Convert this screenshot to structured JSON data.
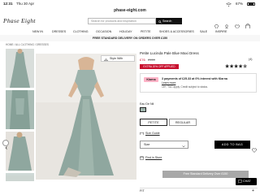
{
  "status": {
    "time": "12:31",
    "date": "Thu 30 Apr",
    "battery": "67%"
  },
  "browser": {
    "url": "phase-eight.com"
  },
  "header": {
    "logo": "Phase Eight",
    "search_placeholder": "Search for products and inspiration",
    "search_button": "Search"
  },
  "nav": {
    "items": [
      "NEW IN",
      "DRESSES",
      "CLOTHING",
      "OCCASION",
      "HOLIDAY",
      "PETITE",
      "SHOES & ACCESSORIES",
      "SALE",
      "INSPIRE"
    ]
  },
  "promo": {
    "text": "FREE STANDARD DELIVERY ON ORDERS OVER £150"
  },
  "breadcrumb": "HOME / ALL CLOTHING / DRESSES",
  "gallery": {
    "style_with": "Style With"
  },
  "product": {
    "name": "Petite Lucinda Pale Blue Maxi Dress",
    "price_now": "£76",
    "price_was": "£169",
    "discount_badge": "EXTRA 20% OFF APPLIED",
    "rating_count": "(4)",
    "stars": 4.5,
    "klarna_label": "Klarna",
    "klarna_line1": "3 payments of £25.33 at 0% interest with Klarna",
    "klarna_link": "Learn more",
    "klarna_line2": "18+, T&C apply, Credit subject to status.",
    "colour_label": "Eau De Nil",
    "fit_options": [
      "PETITE",
      "REGULAR"
    ],
    "size_guide": "Size Guide",
    "size_label": "Size",
    "add_to_bag": "ADD TO BAG",
    "find_in_store": "Find in Store",
    "delivery_banner": "Free Standard Delivery Over £150",
    "chat": "CHAT",
    "fit_section": "FIT",
    "colours": {
      "accent": "#000000",
      "badge": "#c8102e",
      "swatch": "#9fb5ad",
      "delivery_bar": "#a8a8a8",
      "klarna": "#ffb3c7"
    }
  }
}
